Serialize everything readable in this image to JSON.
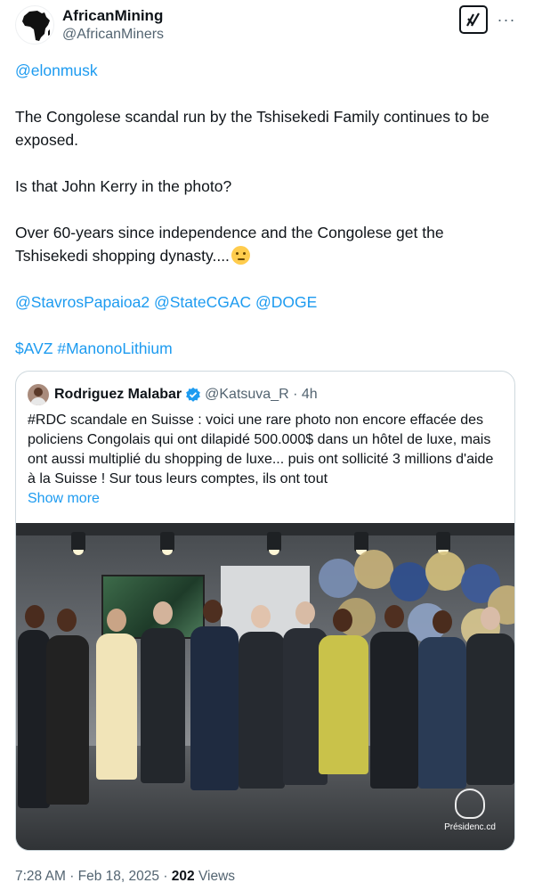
{
  "author": {
    "name": "AfricanMining",
    "handle": "@AfricanMiners"
  },
  "actions": {
    "grok_icon": "grok-icon",
    "more_label": "···"
  },
  "tweet": {
    "mention_elon": "@elonmusk",
    "p1": "The Congolese scandal run by the Tshisekedi Family continues to be exposed.",
    "p2": "Is that John Kerry in the photo?",
    "p3": "Over 60-years since independence and the Congolese get the Tshisekedi shopping dynasty....",
    "mentions": [
      "@StavrosPapaioa2",
      "@StateCGAC",
      "@DOGE"
    ],
    "cashtag": "$AVZ",
    "hashtag": "#ManonoLithium"
  },
  "quote": {
    "name": "Rodriguez Malabar",
    "handle": "@Katsuva_R",
    "time": "4h",
    "text": "#RDC scandale en Suisse : voici une rare photo non encore effacée des policiens Congolais qui ont dilapidé 500.000$ dans un hôtel de luxe, mais ont aussi multiplié du shopping de luxe... puis ont sollicité 3 millions d'aide à la Suisse ! Sur tous leurs comptes, ils ont tout",
    "show_more": "Show more",
    "watermark": "Présidenc.cd"
  },
  "meta": {
    "time": "7:28 AM",
    "date": "Feb 18, 2025",
    "views_count": "202",
    "views_label": "Views"
  },
  "colors": {
    "link": "#1d9bf0",
    "text": "#0f1419",
    "secondary": "#536471",
    "border": "#cfd9de"
  }
}
